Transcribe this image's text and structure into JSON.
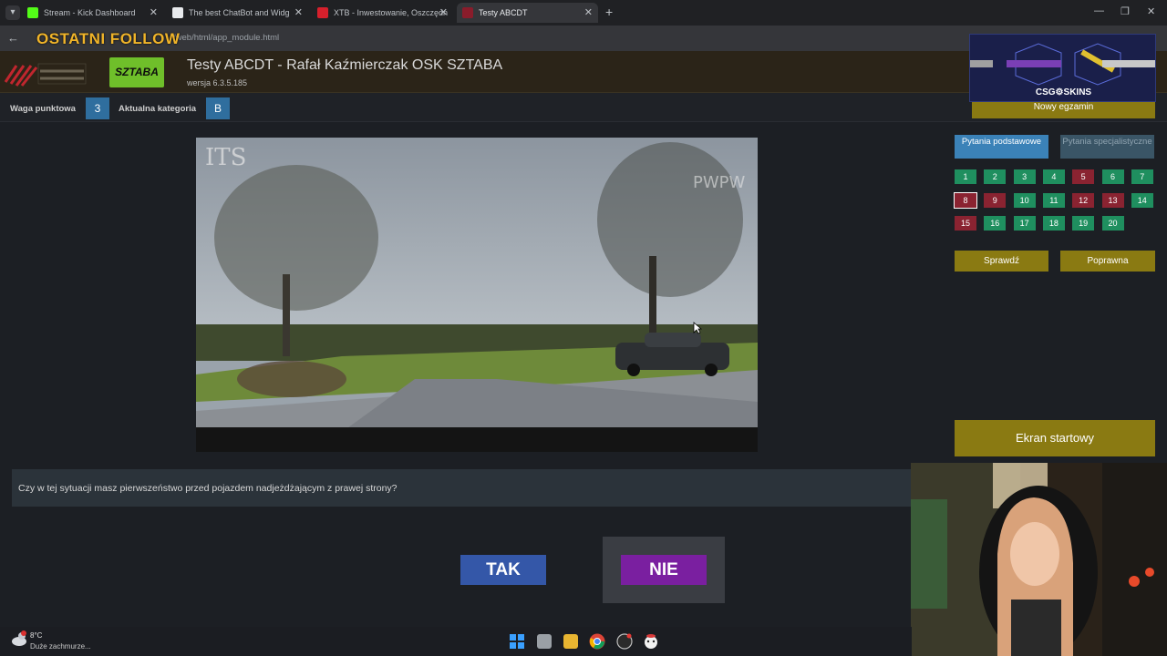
{
  "browser": {
    "tabs": [
      {
        "title": "Stream - Kick Dashboard",
        "favicon_color": "#53fc18"
      },
      {
        "title": "The best ChatBot and Widg",
        "favicon_color": "#e8eaed"
      },
      {
        "title": "XTB - Inwestowanie, Oszczędn",
        "favicon_color": "#d6202c"
      },
      {
        "title": "Testy ABCDT",
        "favicon_color": "#8a1c2b"
      }
    ],
    "url": "/web/html/app_module.html",
    "overlay_title": "OSTATNI FOLLOW"
  },
  "header": {
    "title": "Testy ABCDT - Rafał Kaźmierczak OSK SZTABA",
    "version": "wersja 6.3.5.185",
    "logo_text": "SZTABA"
  },
  "info": {
    "weight_label": "Waga punktowa",
    "weight_value": "3",
    "category_label": "Aktualna kategoria",
    "category_value": "B"
  },
  "sidebar": {
    "new_exam_label": "Nowy egzamin",
    "ad_text": "CSG⚙SKINS",
    "tab_basic": "Pytania podstawowe",
    "tab_special": "Pytania specjalistyczne",
    "question_numbers": [
      {
        "n": "1",
        "state": "green"
      },
      {
        "n": "2",
        "state": "green"
      },
      {
        "n": "3",
        "state": "green"
      },
      {
        "n": "4",
        "state": "green"
      },
      {
        "n": "5",
        "state": "red"
      },
      {
        "n": "6",
        "state": "green"
      },
      {
        "n": "7",
        "state": "green"
      },
      {
        "n": "8",
        "state": "current"
      },
      {
        "n": "9",
        "state": "red"
      },
      {
        "n": "10",
        "state": "green"
      },
      {
        "n": "11",
        "state": "green"
      },
      {
        "n": "12",
        "state": "red"
      },
      {
        "n": "13",
        "state": "red"
      },
      {
        "n": "14",
        "state": "green"
      },
      {
        "n": "15",
        "state": "red"
      },
      {
        "n": "16",
        "state": "green"
      },
      {
        "n": "17",
        "state": "green"
      },
      {
        "n": "18",
        "state": "green"
      },
      {
        "n": "19",
        "state": "green"
      },
      {
        "n": "20",
        "state": "green"
      }
    ],
    "check_label": "Sprawdź",
    "correct_label": "Poprawna",
    "start_screen_label": "Ekran startowy"
  },
  "question": {
    "text": "Czy w tej sytuacji masz pierwszeństwo przed pojazdem nadjeżdżającym z prawej strony?",
    "yes_label": "TAK",
    "no_label": "NIE"
  },
  "taskbar": {
    "temperature": "8°C",
    "weather": "Duże zachmurze..."
  }
}
